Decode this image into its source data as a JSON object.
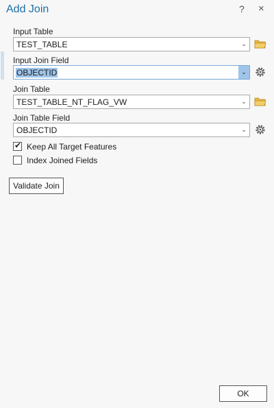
{
  "dialog": {
    "title": "Add Join",
    "help_glyph": "?",
    "close_glyph": "×"
  },
  "form": {
    "input_table": {
      "label": "Input Table",
      "value": "TEST_TABLE"
    },
    "input_join_field": {
      "label": "Input Join Field",
      "value": "OBJECTID"
    },
    "join_table": {
      "label": "Join Table",
      "value": "TEST_TABLE_NT_FLAG_VW"
    },
    "join_table_field": {
      "label": "Join Table Field",
      "value": "OBJECTID"
    },
    "dropdown_glyph": "⌄"
  },
  "options": {
    "keep_all": {
      "label": "Keep All Target Features",
      "checked": true
    },
    "index_joined": {
      "label": "Index Joined Fields",
      "checked": false
    }
  },
  "buttons": {
    "validate_label": "Validate Join",
    "ok_label": "OK"
  },
  "colors": {
    "title": "#1f6fa6",
    "selection": "#9ec4e9",
    "folder": "#e8b84a"
  }
}
